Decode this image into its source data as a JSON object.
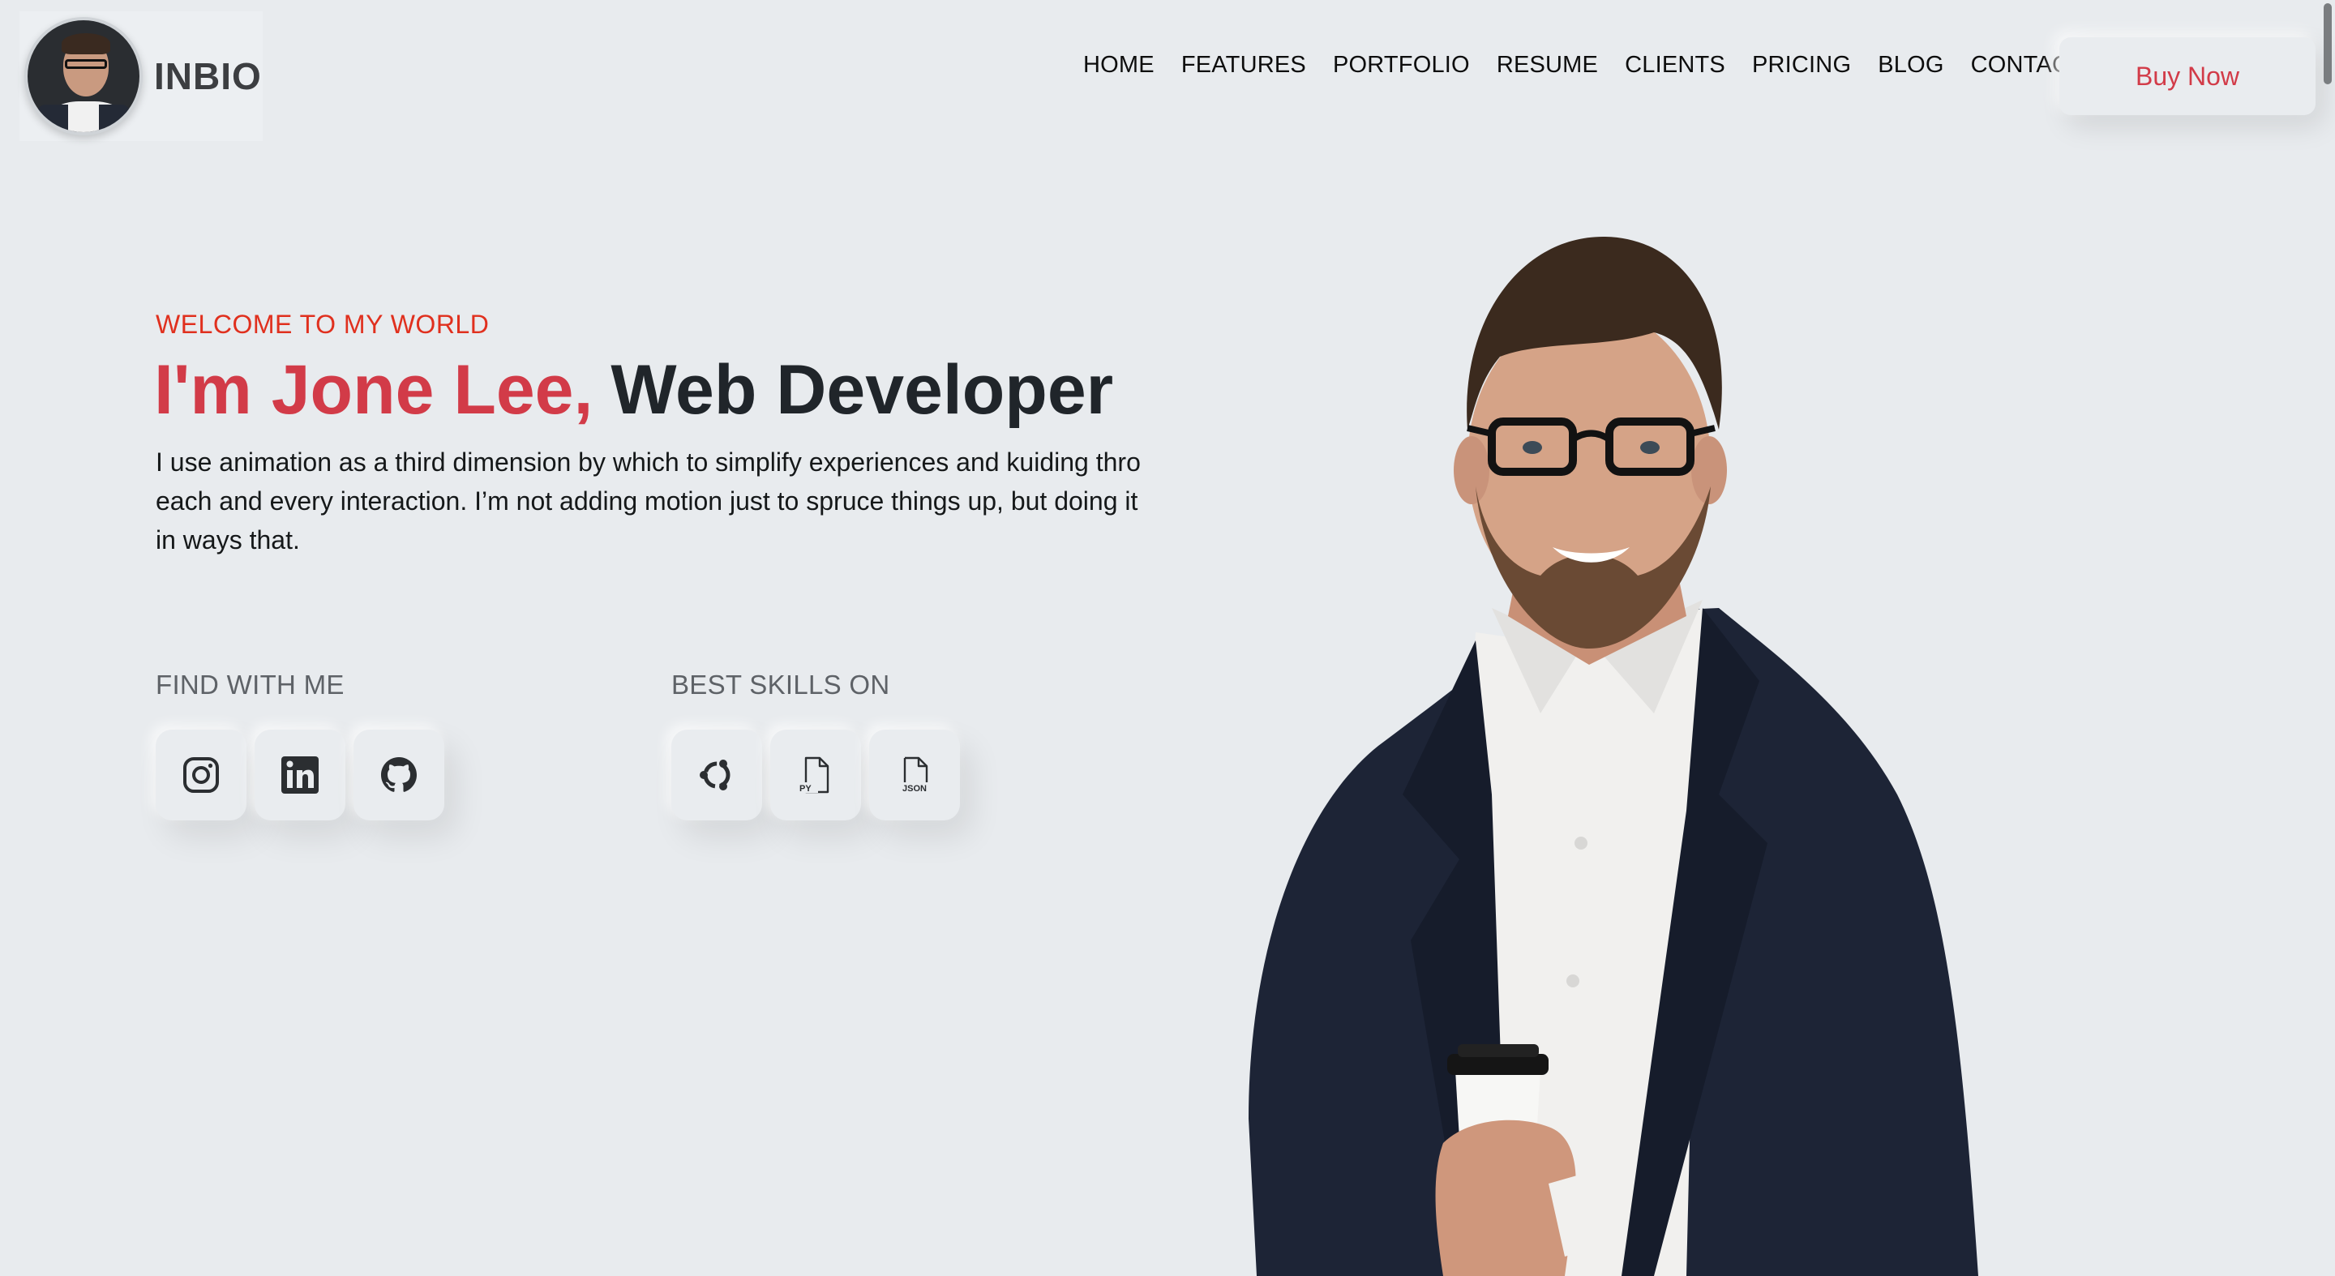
{
  "brand": {
    "name": "INBIO",
    "avatar_icon": "profile-avatar"
  },
  "nav": {
    "items": [
      "HOME",
      "FEATURES",
      "PORTFOLIO",
      "RESUME",
      "CLIENTS",
      "PRICING",
      "BLOG",
      "CONTACT"
    ]
  },
  "cta": {
    "label": "Buy Now"
  },
  "hero": {
    "welcome": "WELCOME TO MY WORLD",
    "name": "I'm Jone Lee,",
    "role": "Web Developer",
    "intro": "I use animation as a third dimension by which to simplify experiences and kuiding thro each and every interaction. I’m not adding motion just to spruce things up, but doing it in ways that."
  },
  "find_with_me": {
    "label": "FIND WITH ME",
    "icons": [
      "instagram-icon",
      "linkedin-icon",
      "github-icon"
    ]
  },
  "best_skills": {
    "label": "BEST SKILLS ON",
    "icons": [
      "ubuntu-icon",
      "python-file-icon",
      "json-file-icon"
    ],
    "python_text": "PY",
    "json_text": "JSON"
  },
  "colors": {
    "accent": "#d23b48",
    "welcome": "#e0301e",
    "background": "#e8ebee"
  }
}
